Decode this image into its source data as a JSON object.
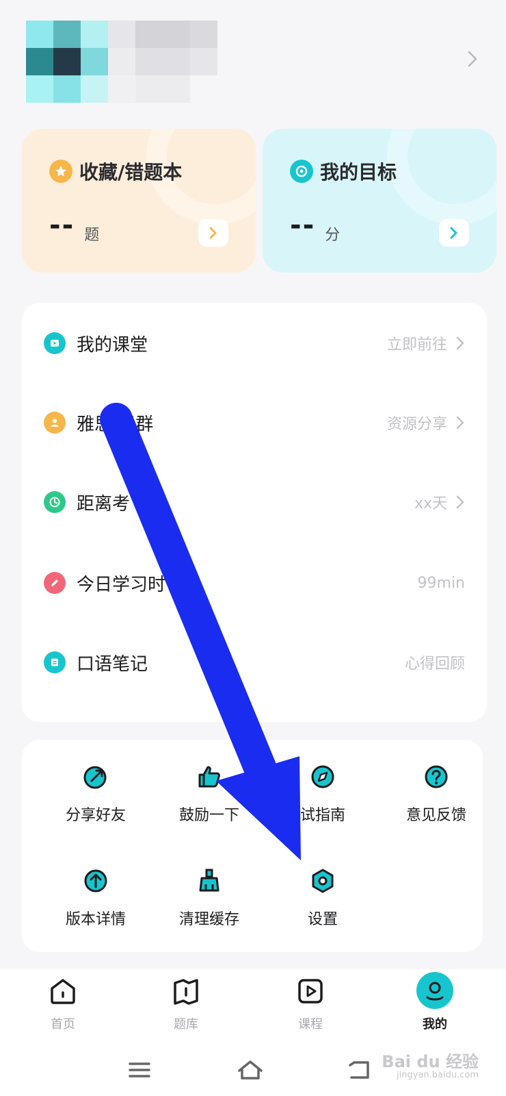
{
  "cards": {
    "favorites": {
      "title": "收藏/错题本",
      "value": "--",
      "unit": "题",
      "accent": "#f6b64a"
    },
    "goal": {
      "title": "我的目标",
      "value": "--",
      "unit": "分",
      "accent": "#17c5cf"
    }
  },
  "list": [
    {
      "label": "我的课堂",
      "value": "立即前往",
      "icon": "play-icon",
      "color": "#17c5cf",
      "chevron": true
    },
    {
      "label": "雅思 考群",
      "value": "资源分享",
      "icon": "user-icon",
      "color": "#f6b64a",
      "chevron": true
    },
    {
      "label": "距离考 有",
      "value": "xx天",
      "icon": "clock-icon",
      "color": "#2ec98a",
      "chevron": true
    },
    {
      "label": "今日学习时",
      "value": "99min",
      "icon": "pencil-icon",
      "color": "#f2667a",
      "chevron": false
    },
    {
      "label": "口语笔记",
      "value": "心得回顾",
      "icon": "note-icon",
      "color": "#17c5cf",
      "chevron": false
    }
  ],
  "grid": [
    {
      "label": "分享好友",
      "icon": "share-icon"
    },
    {
      "label": "鼓励一下",
      "icon": "thumbs-up-icon"
    },
    {
      "label": "试指南",
      "icon": "compass-icon"
    },
    {
      "label": "意见反馈",
      "icon": "question-icon"
    },
    {
      "label": "版本详情",
      "icon": "upgrade-icon"
    },
    {
      "label": "清理缓存",
      "icon": "broom-icon"
    },
    {
      "label": "设置",
      "icon": "settings-icon"
    }
  ],
  "nav": [
    {
      "label": "首页",
      "icon": "home-icon"
    },
    {
      "label": "题库",
      "icon": "question-bank-icon"
    },
    {
      "label": "课程",
      "icon": "course-icon"
    },
    {
      "label": "我的",
      "icon": "profile-icon",
      "active": true
    }
  ],
  "watermark": {
    "brand": "Bai du 经验",
    "url": "jingyan.baidu.com"
  },
  "colors": {
    "accent": "#17c5cf",
    "annotation": "#1a2cf0"
  }
}
